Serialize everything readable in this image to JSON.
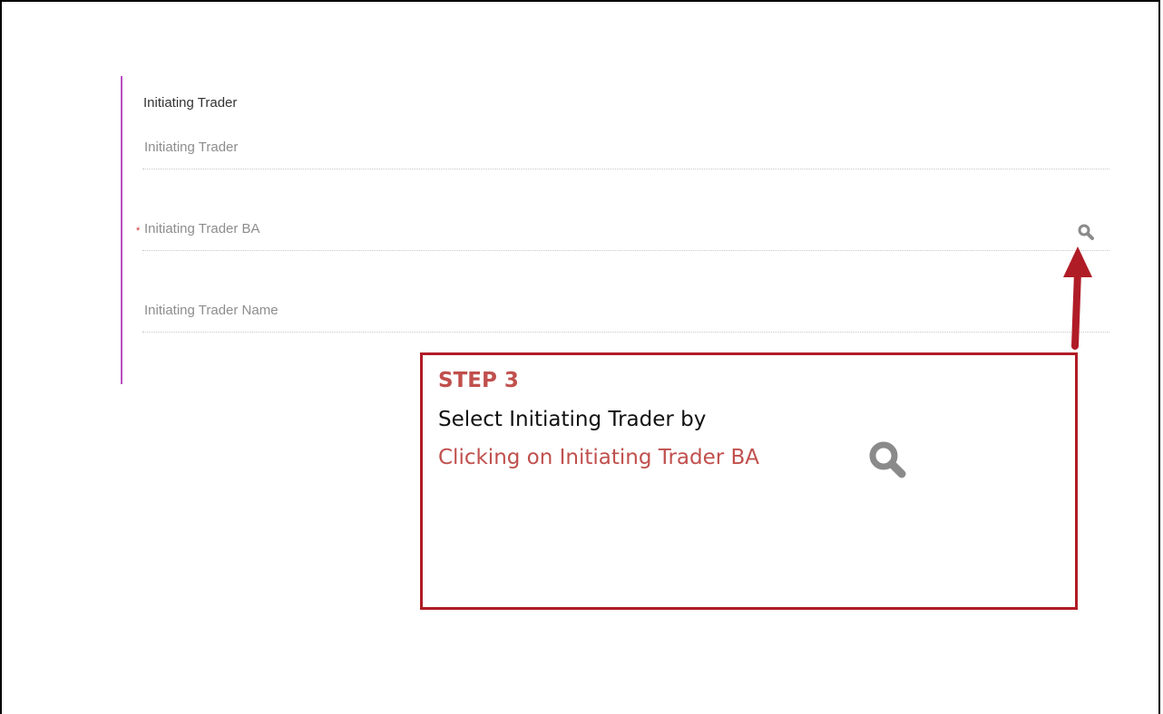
{
  "section": {
    "title": "Initiating Trader"
  },
  "fields": {
    "initiating_trader": {
      "placeholder": "Initiating Trader",
      "value": ""
    },
    "initiating_trader_ba": {
      "placeholder": "Initiating Trader BA",
      "value": "",
      "required": true,
      "required_marker": "*"
    },
    "initiating_trader_name": {
      "placeholder": "Initiating Trader Name",
      "value": ""
    }
  },
  "icons": {
    "lookup": "search-icon"
  },
  "callout": {
    "step": "STEP 3",
    "line1": "Select Initiating Trader by",
    "line2": "Clicking on Initiating Trader BA"
  },
  "colors": {
    "section_accent": "#b84fc0",
    "required": "#d03030",
    "annotation": "#b01c26",
    "annotation_text": "#c0504d",
    "icon": "#8a8a8a"
  }
}
